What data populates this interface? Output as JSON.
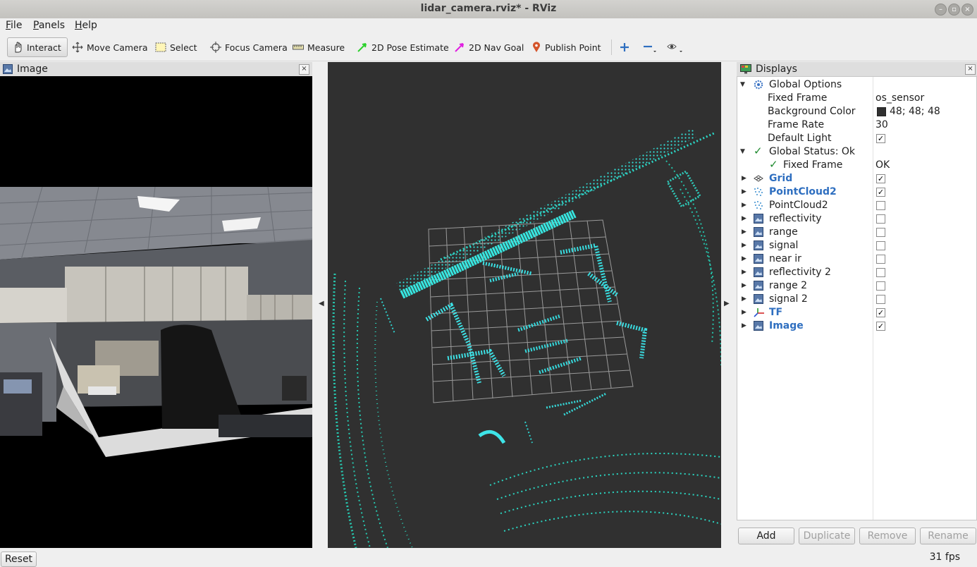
{
  "window": {
    "title": "lidar_camera.rviz* - RViz"
  },
  "menu": {
    "file": "File",
    "panels": "Panels",
    "help": "Help"
  },
  "toolbar": {
    "interact": "Interact",
    "move_camera": "Move Camera",
    "select": "Select",
    "focus_camera": "Focus Camera",
    "measure": "Measure",
    "pose_estimate": "2D Pose Estimate",
    "nav_goal": "2D Nav Goal",
    "publish_point": "Publish Point"
  },
  "image_panel": {
    "title": "Image"
  },
  "displays_panel": {
    "title": "Displays",
    "global_options": {
      "label": "Global Options",
      "fixed_frame_label": "Fixed Frame",
      "fixed_frame_value": "os_sensor",
      "background_color_label": "Background Color",
      "background_color_value": "48; 48; 48",
      "background_color_swatch": "#303030",
      "frame_rate_label": "Frame Rate",
      "frame_rate_value": "30",
      "default_light_label": "Default Light",
      "default_light_checked": true
    },
    "global_status": {
      "label": "Global Status: Ok",
      "fixed_frame_label": "Fixed Frame",
      "fixed_frame_value": "OK"
    },
    "items": [
      {
        "label": "Grid",
        "icon": "grid-icon",
        "enabled": true,
        "highlight": true
      },
      {
        "label": "PointCloud2",
        "icon": "pointcloud-icon",
        "enabled": true,
        "highlight": true
      },
      {
        "label": "PointCloud2",
        "icon": "pointcloud-icon",
        "enabled": false,
        "highlight": false
      },
      {
        "label": "reflectivity",
        "icon": "image-icon",
        "enabled": false,
        "highlight": false
      },
      {
        "label": "range",
        "icon": "image-icon",
        "enabled": false,
        "highlight": false
      },
      {
        "label": "signal",
        "icon": "image-icon",
        "enabled": false,
        "highlight": false
      },
      {
        "label": "near ir",
        "icon": "image-icon",
        "enabled": false,
        "highlight": false
      },
      {
        "label": "reflectivity 2",
        "icon": "image-icon",
        "enabled": false,
        "highlight": false
      },
      {
        "label": "range 2",
        "icon": "image-icon",
        "enabled": false,
        "highlight": false
      },
      {
        "label": "signal 2",
        "icon": "image-icon",
        "enabled": false,
        "highlight": false
      },
      {
        "label": "TF",
        "icon": "tf-icon",
        "enabled": true,
        "highlight": true
      },
      {
        "label": "Image",
        "icon": "image-icon",
        "enabled": true,
        "highlight": true
      }
    ],
    "buttons": {
      "add": "Add",
      "duplicate": "Duplicate",
      "remove": "Remove",
      "rename": "Rename"
    }
  },
  "status": {
    "reset": "Reset",
    "fps": "31 fps"
  },
  "colors": {
    "accent": "#2f6fc0",
    "viewport_bg": "#303030",
    "points": "#2ee6c8"
  }
}
